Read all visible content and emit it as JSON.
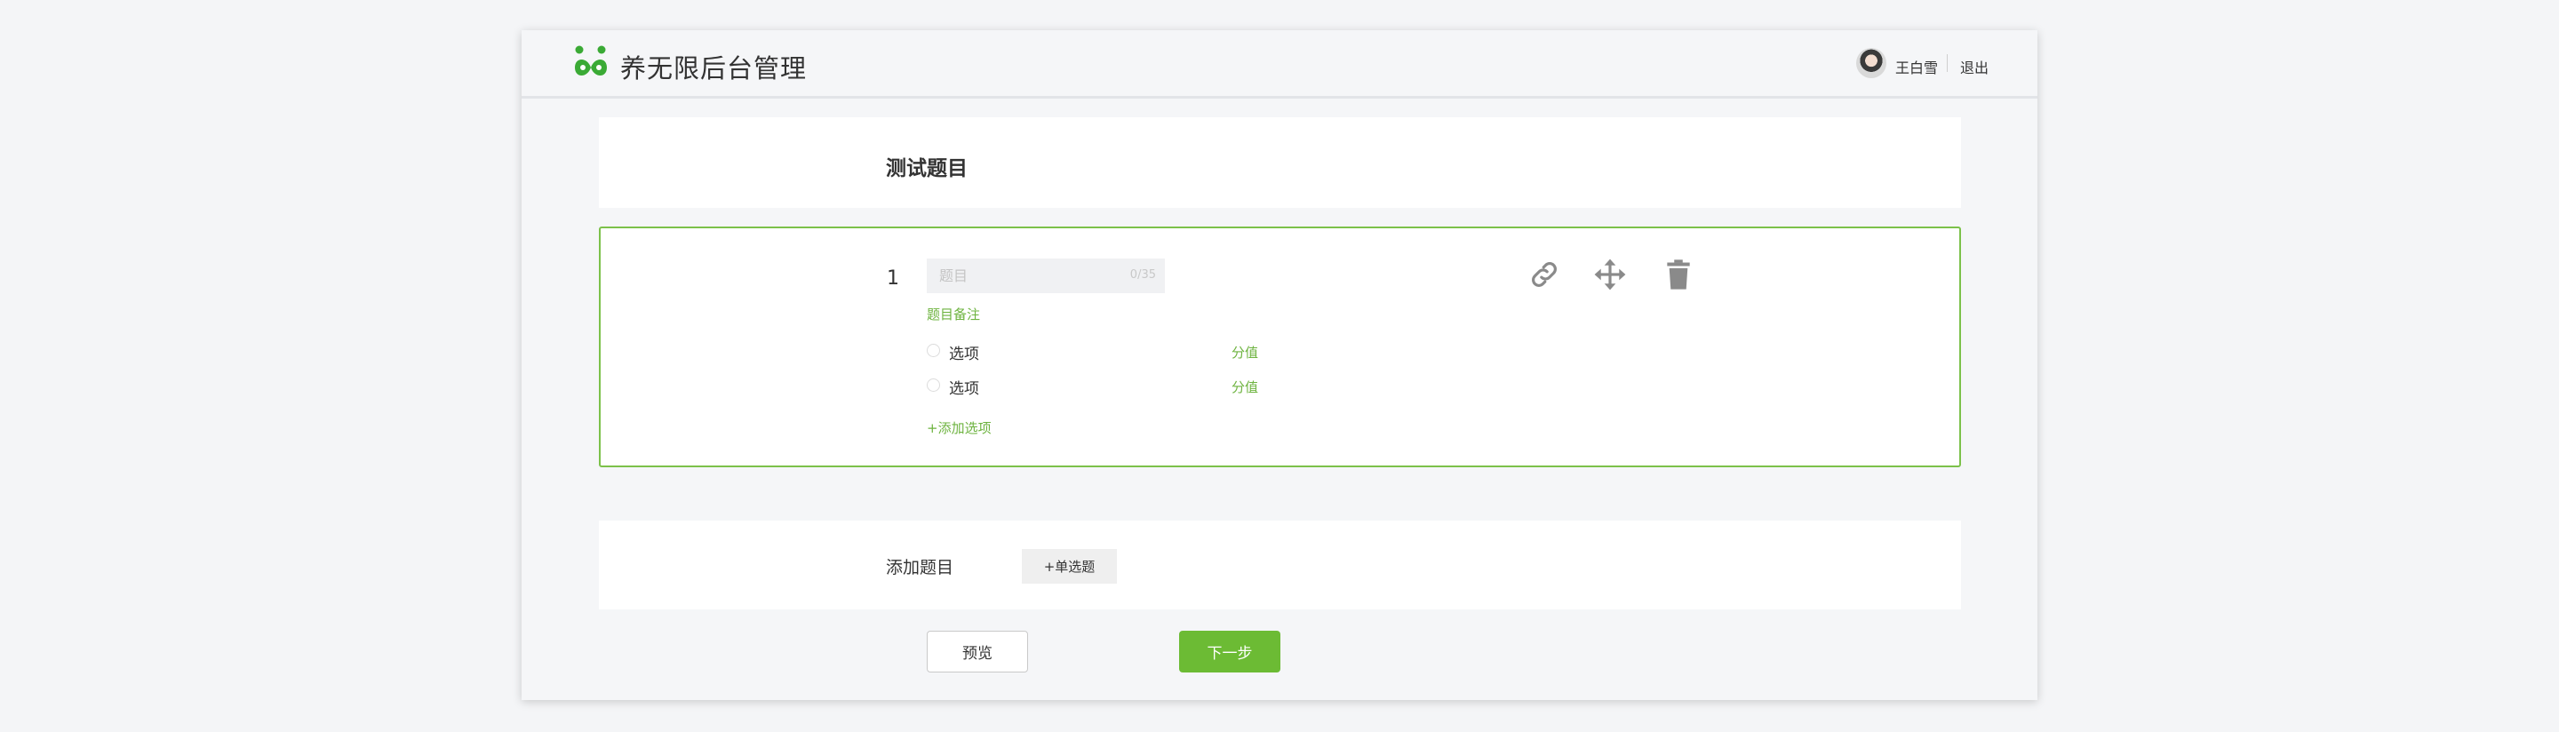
{
  "header": {
    "brand": "养无限后台管理",
    "username": "王白雪",
    "logout_label": "退出",
    "brand_color": "#3aaa35"
  },
  "survey": {
    "title": "测试题目"
  },
  "question": {
    "number": "1",
    "placeholder": "题目",
    "counter": "0/35",
    "note_label": "题目备注",
    "options": [
      {
        "label": "选项",
        "score_label": "分值"
      },
      {
        "label": "选项",
        "score_label": "分值"
      }
    ],
    "add_option_label": "+添加选项",
    "tools": [
      "link-icon",
      "move-icon",
      "trash-icon"
    ],
    "accent_color": "#7cc14a"
  },
  "add_question": {
    "label": "添加题目",
    "single_choice_label": "+单选题"
  },
  "footer": {
    "preview_label": "预览",
    "next_label": "下一步",
    "next_color": "#6cbb34"
  }
}
